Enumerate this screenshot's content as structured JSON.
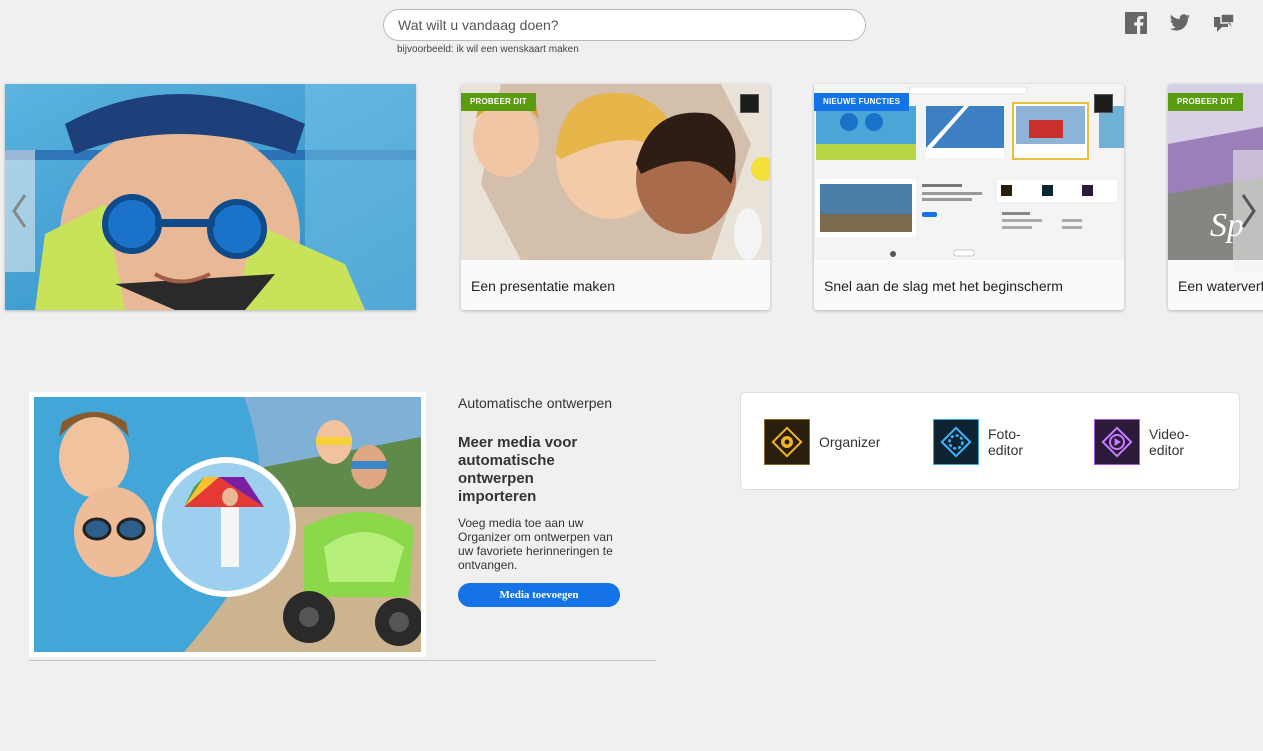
{
  "search": {
    "placeholder": "Wat wilt u vandaag doen?",
    "hint": "bijvoorbeeld: ik wil een wenskaart maken"
  },
  "social": [
    "facebook-icon",
    "twitter-icon",
    "feedback-icon"
  ],
  "carousel": {
    "cards": [
      {
        "tag": "",
        "caption": ""
      },
      {
        "tag": "PROBEER DIT",
        "caption": "Een presentatie maken"
      },
      {
        "tag": "NIEUWE FUNCTIES",
        "caption": "Snel aan de slag met het beginscherm"
      },
      {
        "tag": "PROBEER DIT",
        "caption": "Een waterverf"
      }
    ]
  },
  "auto_designs": {
    "section_title": "Automatische ontwerpen",
    "heading": "Meer media voor automatische ontwerpen importeren",
    "description": "Voeg media toe aan uw Organizer om ontwerpen van uw favoriete herinneringen te ontvangen.",
    "button": "Media toevoegen"
  },
  "apps": [
    {
      "label": "Organizer"
    },
    {
      "label": "Foto-\neditor"
    },
    {
      "label": "Video-\neditor"
    }
  ],
  "colors": {
    "accent": "#1473e6",
    "tag_green": "#5a9c0f",
    "background": "#f0f0f0"
  }
}
